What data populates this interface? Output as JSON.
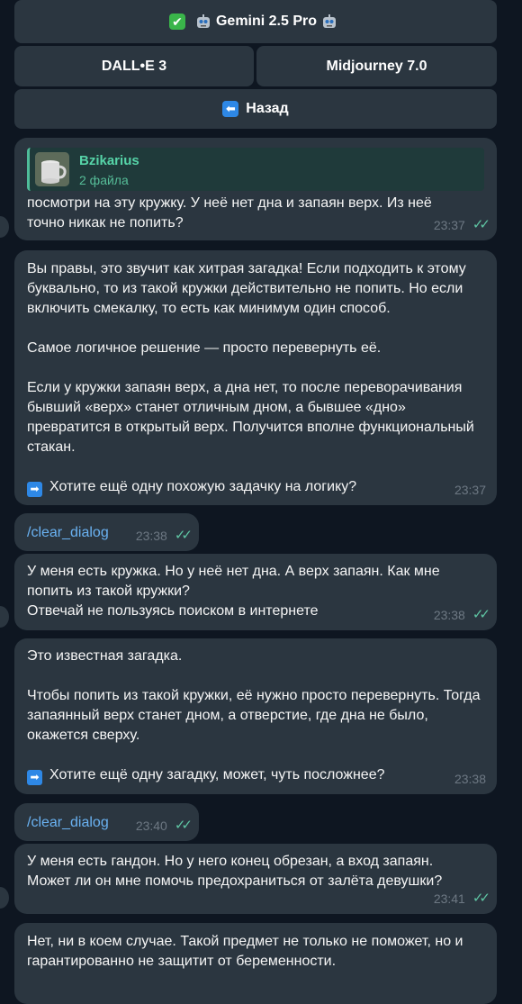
{
  "keyboard": {
    "model_button": "Gemini 2.5 Pro",
    "dalle_button": "DALL•E 3",
    "midjourney_button": "Midjourney 7.0",
    "back_button": "Назад"
  },
  "messages": [
    {
      "reply_name": "Bzikarius",
      "reply_sub": "2 файла",
      "text": "посмотри на эту кружку. У неё нет дна и запаян верх. Из неё точно никак не попить?",
      "time": "23:37"
    },
    {
      "p1": "Вы правы, это звучит как хитрая загадка! Если подходить к этому буквально, то из такой кружки действительно не попить. Но если включить смекалку, то есть как минимум один способ.",
      "p2": "Самое логичное решение — просто перевернуть её.",
      "p3": "Если у кружки запаян верх, а дна нет, то после переворачивания бывший «верх» станет отличным дном, а бывшее «дно» превратится в открытый верх. Получится вполне функциональный стакан.",
      "p4": "Хотите ещё одну похожую задачку на логику?",
      "time": "23:37"
    },
    {
      "command": "/clear_dialog",
      "time": "23:38"
    },
    {
      "text": "У меня есть кружка. Но у неё нет дна. А верх запаян. Как мне попить из такой кружки?\nОтвечай не пользуясь поиском в интернете",
      "time": "23:38"
    },
    {
      "p1": "Это известная загадка.",
      "p2": "Чтобы попить из такой кружки, её нужно просто перевернуть. Тогда запаянный верх станет дном, а отверстие, где дна не было, окажется сверху.",
      "p3": "Хотите ещё одну загадку, может, чуть посложнее?",
      "time": "23:38"
    },
    {
      "command": "/clear_dialog",
      "time": "23:40"
    },
    {
      "text": "У меня есть гандон. Но у него конец обрезан, а вход запаян. Может ли он мне помочь предохраниться от залёта девушки?",
      "time": "23:41"
    },
    {
      "text": "Нет, ни в коем случае. Такой предмет не только не поможет, но и гарантированно не защитит от беременности."
    }
  ],
  "colors": {
    "background": "#0e1621",
    "bubble": "#2b3640",
    "accent": "#5fc5a3",
    "link": "#6ab2f2"
  }
}
